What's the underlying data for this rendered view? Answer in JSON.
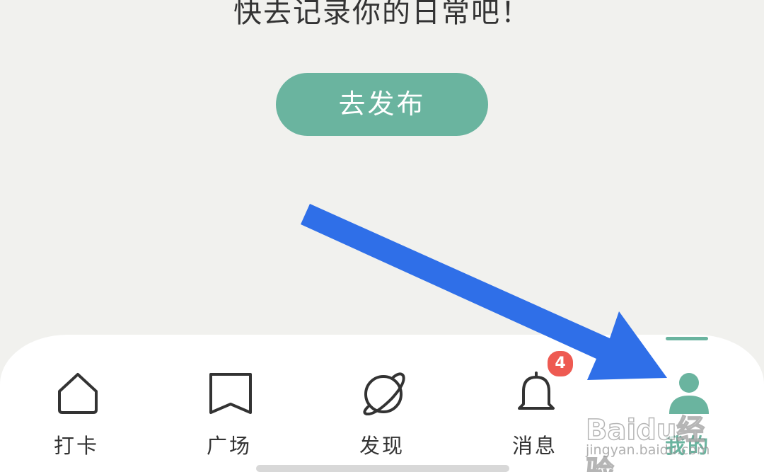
{
  "empty_state": {
    "message": "快去记录你的日常吧！",
    "publish_label": "去发布"
  },
  "tab_bar": {
    "active_color": "#6ab49f",
    "items": [
      {
        "label": "打卡",
        "icon": "home-icon"
      },
      {
        "label": "广场",
        "icon": "book-icon"
      },
      {
        "label": "发现",
        "icon": "planet-icon"
      },
      {
        "label": "消息",
        "icon": "bell-icon",
        "badge": "4"
      },
      {
        "label": "我的",
        "icon": "user-icon",
        "active": true
      }
    ]
  },
  "annotation": {
    "arrow_color": "#2f6fe8"
  },
  "watermark": {
    "brand": "Baidu经验",
    "site": "jingyan.baidu.com"
  }
}
